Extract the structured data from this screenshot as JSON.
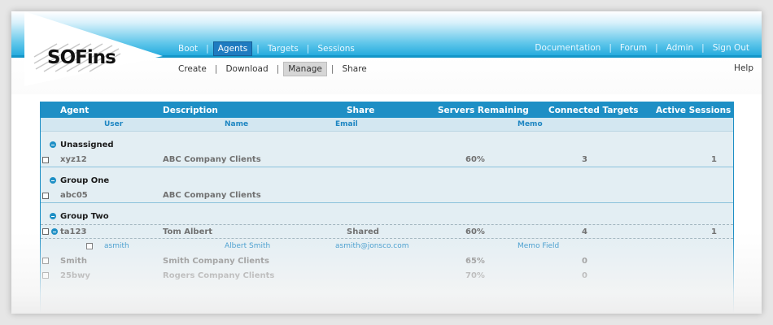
{
  "app": {
    "logo": "SOFins"
  },
  "nav": {
    "left": [
      "Boot",
      "Agents",
      "Targets",
      "Sessions"
    ],
    "active": "Agents",
    "right": [
      "Documentation",
      "Forum",
      "Admin",
      "Sign Out"
    ]
  },
  "subnav": {
    "items": [
      "Create",
      "Download",
      "Manage",
      "Share"
    ],
    "active": "Manage",
    "help": "Help"
  },
  "table": {
    "headers": [
      "Agent",
      "Description",
      "Share",
      "Servers Remaining",
      "Connected Targets",
      "Active Sessions"
    ],
    "subheaders": [
      "User",
      "Name",
      "Email",
      "Memo"
    ],
    "groups": [
      {
        "name": "Unassigned",
        "rows": [
          {
            "agent": "xyz12",
            "description": "ABC Company Clients",
            "share": "",
            "servers": "60%",
            "targets": "3",
            "sessions": "1"
          }
        ]
      },
      {
        "name": "Group One",
        "rows": [
          {
            "agent": "abc05",
            "description": "ABC Company Clients",
            "share": "",
            "servers": "",
            "targets": "",
            "sessions": ""
          }
        ]
      },
      {
        "name": "Group Two",
        "rows": [
          {
            "agent": "ta123",
            "description": "Tom Albert",
            "share": "Shared",
            "servers": "60%",
            "targets": "4",
            "sessions": "1"
          },
          {
            "agent": "Smith",
            "description": "Smith Company Clients",
            "share": "",
            "servers": "65%",
            "targets": "0",
            "sessions": ""
          },
          {
            "agent": "25bwy",
            "description": "Rogers Company Clients",
            "share": "",
            "servers": "70%",
            "targets": "0",
            "sessions": ""
          }
        ]
      }
    ],
    "member": {
      "user": "asmith",
      "name": "Albert Smith",
      "email": "asmith@jonsco.com",
      "memo": "Memo Field"
    }
  },
  "colors": {
    "accent": "#1e8fc5",
    "header_band": "#1fa8dc",
    "link": "#2a8fc8"
  }
}
